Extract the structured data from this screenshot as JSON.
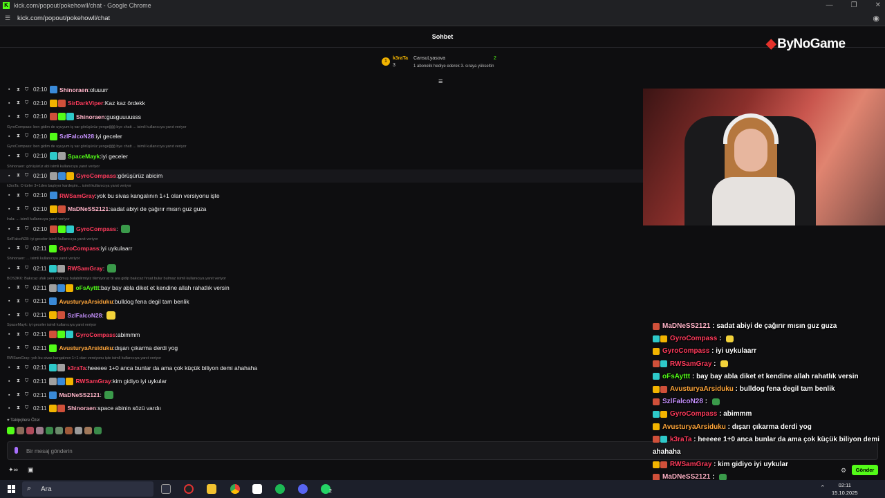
{
  "browser": {
    "title": "kick.com/popout/pokehowll/chat - Google Chrome",
    "url": "kick.com/popout/pokehowll/chat"
  },
  "chat": {
    "header": "Sohbet",
    "brand": "ByNoGame",
    "pinned": {
      "user1": "k3raTa",
      "count1": "3",
      "rank": "1",
      "user2": "CansuLyasova",
      "count2": "2",
      "message": "1 abonelik hediye ederek 3. sıraya yükseltin"
    },
    "messages": [
      {
        "reply": "",
        "time": "02:10",
        "user": "Shinoraen",
        "color": "#ffb4c8",
        "text": "oluuurr"
      },
      {
        "reply": "",
        "time": "02:10",
        "user": "SirDarkViper",
        "color": "#ff3b5c",
        "text": "Kaz kaz ördekk"
      },
      {
        "reply": "",
        "time": "02:10",
        "user": "Shinoraen",
        "color": "#ffb4c8",
        "text": "gusguuuusss"
      },
      {
        "reply": "GyroCompass: ben gidim de uyuyum iş var görüşürüz yengeğğğ bye chatt ... isimli kullanıcıya yanıt veriyor",
        "time": "02:10",
        "user": "SzlFalcoN28",
        "color": "#c792ff",
        "text": "iyi geceler"
      },
      {
        "reply": "GyroCompass: ben gidim de uyuyum iş var görüşürüz yengeğğğ bye chatt ... isimli kullanıcıya yanıt veriyor",
        "time": "02:10",
        "user": "SpaceMayk",
        "color": "#53fc18",
        "text": "iyi geceler"
      },
      {
        "reply": "Shinoraen: görüşürüz abi isimli kullanıcıya yanıt veriyor",
        "time": "02:10",
        "user": "GyroCompass",
        "color": "#ff3b5c",
        "text": "görüşürüz abicim"
      },
      {
        "reply": "k3raTa: O türler 3+1den başlıyor kardeşim... isimli kullanıcıya yanıt veriyor",
        "time": "02:10",
        "user": "RWSamGray",
        "color": "#ff3b5c",
        "text": "yok bu sivas kangalının 1+1 olan versiyonu işte"
      },
      {
        "reply": "",
        "time": "02:10",
        "user": "MaDNeSS2121",
        "color": "#ffb4c8",
        "text": "sadat abiyi de çağırır mısın guz guza"
      },
      {
        "reply": "lrala: ... isimli kullanıcıya yanıt veriyor",
        "time": "02:10",
        "user": "GyroCompass",
        "color": "#ff3b5c",
        "text": ""
      },
      {
        "reply": "SzlFalcoN28: iyi geceler isimli kullanıcıya yanıt veriyor",
        "time": "02:11",
        "user": "GyroCompass",
        "color": "#ff3b5c",
        "text": "iyi uykulaarr"
      },
      {
        "reply": "Shinoraen: ... isimli kullanıcıya yanıt veriyor",
        "time": "02:11",
        "user": "RWSamGray",
        "color": "#ff3b5c",
        "text": ""
      },
      {
        "reply": "BOS3KK: Bakıcaz ufak yeni doğmuş bulabilirmiyiz tikmiyoruz bi ara gidip bakıcaz fırsat bulur bulmaz isimli kullanıcıya yanıt veriyor",
        "time": "02:11",
        "user": "oFsAyttt",
        "color": "#53fc18",
        "text": "bay bay abla diket et kendine allah rahatlık versin"
      },
      {
        "reply": "",
        "time": "02:11",
        "user": "AvusturyaArsiduku",
        "color": "#ffa63b",
        "text": "bulldog fena degil tam benlik"
      },
      {
        "reply": "",
        "time": "02:11",
        "user": "SzlFalcoN28",
        "color": "#c792ff",
        "text": ""
      },
      {
        "reply": "SpaceMayk: iyi geceler isimli kullanıcıya yanıt veriyor",
        "time": "02:11",
        "user": "GyroCompass",
        "color": "#ff3b5c",
        "text": "abimmm"
      },
      {
        "reply": "",
        "time": "02:11",
        "user": "AvusturyaArsiduku",
        "color": "#ffa63b",
        "text": "dışarı çıkarma derdi yog"
      },
      {
        "reply": "RWSamGray: yok bu sivas kangalının 1+1 olan versiyonu işte isimli kullanıcıya yanıt veriyor",
        "time": "02:11",
        "user": "k3raTa",
        "color": "#ff3b5c",
        "text": "heeeee 1+0 anca bunlar da ama çok küçük biliyon demi ahahaha"
      },
      {
        "reply": "",
        "time": "02:11",
        "user": "RWSamGray",
        "color": "#ff3b5c",
        "text": "kim gidiyo iyi uykular"
      },
      {
        "reply": "",
        "time": "02:11",
        "user": "MaDNeSS2121",
        "color": "#ffb4c8",
        "text": ""
      },
      {
        "reply": "",
        "time": "02:11",
        "user": "Shinoraen",
        "color": "#ffb4c8",
        "text": "space abinin sözü vardıı"
      }
    ],
    "followers_label": "Takipçilere Özel",
    "input_placeholder": "Bir mesaj gönderin",
    "send_label": "Gönder"
  },
  "overlay": [
    {
      "user": "MaDNeSS2121",
      "color": "#ffb4c8",
      "text": "sadat abiyi de çağırır mısın guz guza"
    },
    {
      "user": "GyroCompass",
      "color": "#ff3b5c",
      "text": ""
    },
    {
      "user": "GyroCompass",
      "color": "#ff3b5c",
      "text": "iyi uykulaarr"
    },
    {
      "user": "RWSamGray",
      "color": "#ff3b5c",
      "text": ""
    },
    {
      "user": "oFsAyttt",
      "color": "#53fc18",
      "text": "bay bay abla diket et kendine allah rahatlık versin"
    },
    {
      "user": "AvusturyaArsiduku",
      "color": "#ffa63b",
      "text": "bulldog fena degil tam benlik"
    },
    {
      "user": "SzlFalcoN28",
      "color": "#c792ff",
      "text": ""
    },
    {
      "user": "GyroCompass",
      "color": "#ff3b5c",
      "text": "abimmm"
    },
    {
      "user": "AvusturyaArsiduku",
      "color": "#ffa63b",
      "text": "dışarı çıkarma derdi yog"
    },
    {
      "user": "k3raTa",
      "color": "#ff3b5c",
      "text": "heeeee 1+0 anca bunlar da ama çok küçük biliyon demi"
    },
    {
      "user": "",
      "color": "#ffffff",
      "text": "ahahaha"
    },
    {
      "user": "RWSamGray",
      "color": "#ff3b5c",
      "text": "kim gidiyo iyi uykular"
    },
    {
      "user": "MaDNeSS2121",
      "color": "#ffb4c8",
      "text": ""
    },
    {
      "user": "Shinoraen",
      "color": "#ffb4c8",
      "text": "space abinin sözü vardıı"
    }
  ],
  "taskbar": {
    "search_label": "Ara",
    "time": "02:11",
    "date": "15.10.2025",
    "whatsapp_badge": "2"
  }
}
